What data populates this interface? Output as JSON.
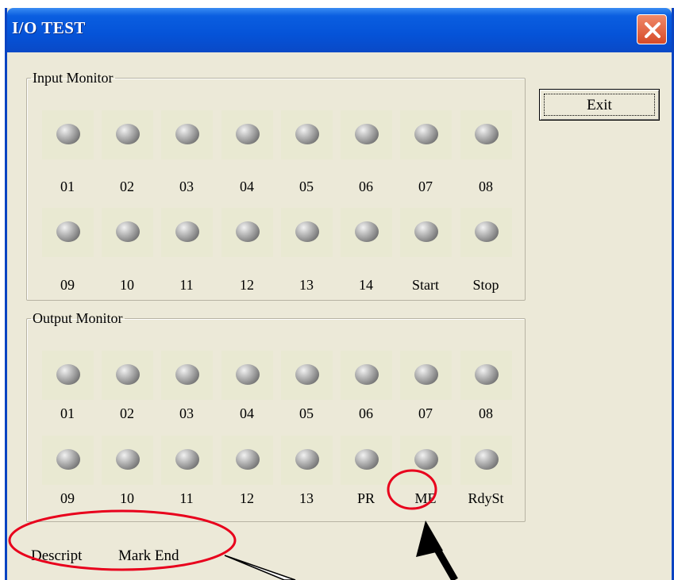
{
  "window": {
    "title": "I/O TEST"
  },
  "buttons": {
    "exit_label": "Exit"
  },
  "input_monitor": {
    "title": "Input Monitor",
    "labels": [
      "01",
      "02",
      "03",
      "04",
      "05",
      "06",
      "07",
      "08",
      "09",
      "10",
      "11",
      "12",
      "13",
      "14",
      "Start",
      "Stop"
    ]
  },
  "output_monitor": {
    "title": "Output Monitor",
    "labels": [
      "01",
      "02",
      "03",
      "04",
      "05",
      "06",
      "07",
      "08",
      "09",
      "10",
      "11",
      "12",
      "13",
      "PR",
      "ME",
      "RdySt"
    ]
  },
  "status": {
    "descript_label": "Descript",
    "descript_value": "Mark End"
  },
  "annotation_color": "#e8001c",
  "icons": [
    "close-icon",
    "indicator-led"
  ]
}
